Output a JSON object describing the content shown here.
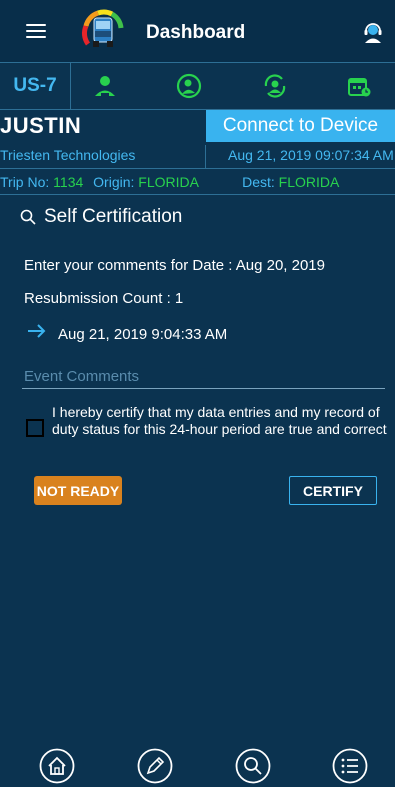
{
  "header": {
    "title": "Dashboard",
    "menu_icon": "hamburger-menu-icon",
    "logo_icon": "truck-gauge-logo",
    "support_icon": "support-headset-icon"
  },
  "unit": {
    "id": "US-7",
    "status_icons": [
      "driver-icon",
      "sleeper-icon",
      "driver-rotate-icon",
      "calendar-clock-icon"
    ],
    "status_color": "#28d24e"
  },
  "driver": {
    "name": "JUSTIN",
    "company": "Triesten Technologies",
    "connect_label": "Connect to Device",
    "datetime": "Aug 21, 2019 09:07:34 AM"
  },
  "trip": {
    "no_label": "Trip No:",
    "no_value": "1134",
    "origin_label": "Origin:",
    "origin_value": "FLORIDA",
    "dest_label": "Dest:",
    "dest_value": "FLORIDA"
  },
  "certification": {
    "heading": "Self Certification",
    "comments_for_date": "Enter your comments for Date : Aug 20, 2019",
    "resubmission": "Resubmission Count : 1",
    "timestamp": "Aug 21, 2019 9:04:33 AM",
    "comments_placeholder": "Event Comments",
    "certify_statement": "I hereby certify that my data entries and my record of duty status for this 24-hour period are true and correct",
    "not_ready_label": "NOT READY",
    "certify_label": "CERTIFY"
  },
  "colors": {
    "accent": "#39b3ef",
    "background": "#0b3350",
    "warning": "#d9821e",
    "green": "#28d24e"
  },
  "bottom_nav": [
    "home-icon",
    "edit-pencil-icon",
    "search-icon",
    "list-menu-icon"
  ]
}
